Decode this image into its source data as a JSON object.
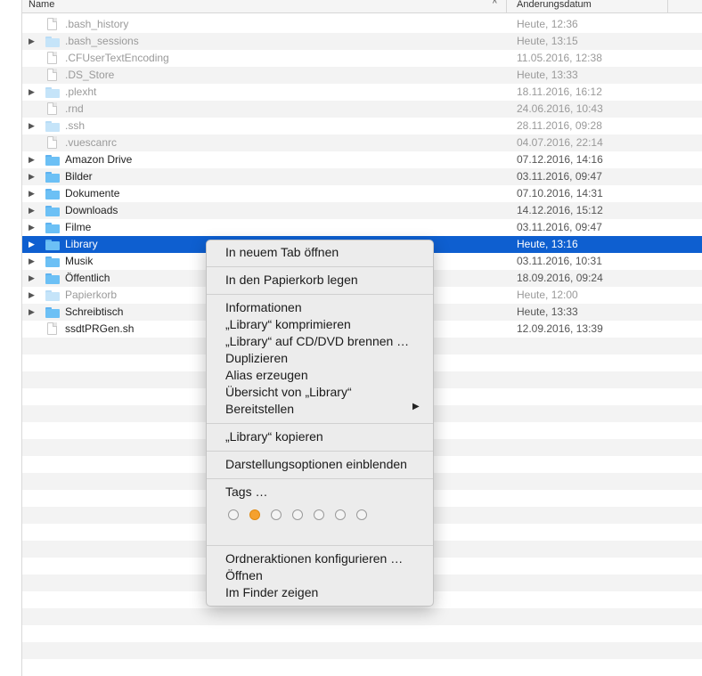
{
  "header": {
    "name_label": "Name",
    "sort_indicator": "^",
    "date_label": "Änderungsdatum"
  },
  "files": [
    {
      "name": ".bash_history",
      "date": "Heute, 12:36",
      "kind": "file",
      "dim": true,
      "expandable": false
    },
    {
      "name": ".bash_sessions",
      "date": "Heute, 13:15",
      "kind": "folder",
      "dim": true,
      "expandable": true
    },
    {
      "name": ".CFUserTextEncoding",
      "date": "11.05.2016, 12:38",
      "kind": "file",
      "dim": true,
      "expandable": false
    },
    {
      "name": ".DS_Store",
      "date": "Heute, 13:33",
      "kind": "file",
      "dim": true,
      "expandable": false
    },
    {
      "name": ".plexht",
      "date": "18.11.2016, 16:12",
      "kind": "folder",
      "dim": true,
      "expandable": true
    },
    {
      "name": ".rnd",
      "date": "24.06.2016, 10:43",
      "kind": "file",
      "dim": true,
      "expandable": false
    },
    {
      "name": ".ssh",
      "date": "28.11.2016, 09:28",
      "kind": "folder",
      "dim": true,
      "expandable": true
    },
    {
      "name": ".vuescanrc",
      "date": "04.07.2016, 22:14",
      "kind": "file",
      "dim": true,
      "expandable": false
    },
    {
      "name": "Amazon Drive",
      "date": "07.12.2016, 14:16",
      "kind": "folder",
      "dim": false,
      "expandable": true
    },
    {
      "name": "Bilder",
      "date": "03.11.2016, 09:47",
      "kind": "folder",
      "dim": false,
      "expandable": true
    },
    {
      "name": "Dokumente",
      "date": "07.10.2016, 14:31",
      "kind": "folder",
      "dim": false,
      "expandable": true
    },
    {
      "name": "Downloads",
      "date": "14.12.2016, 15:12",
      "kind": "folder",
      "dim": false,
      "expandable": true
    },
    {
      "name": "Filme",
      "date": "03.11.2016, 09:47",
      "kind": "folder",
      "dim": false,
      "expandable": true
    },
    {
      "name": "Library",
      "date": "Heute, 13:16",
      "kind": "folder",
      "dim": false,
      "expandable": true,
      "selected": true
    },
    {
      "name": "Musik",
      "date": "03.11.2016, 10:31",
      "kind": "folder",
      "dim": false,
      "expandable": true
    },
    {
      "name": "Öffentlich",
      "date": "18.09.2016, 09:24",
      "kind": "folder",
      "dim": false,
      "expandable": true
    },
    {
      "name": "Papierkorb",
      "date": "Heute, 12:00",
      "kind": "folder",
      "dim": true,
      "expandable": true
    },
    {
      "name": "Schreibtisch",
      "date": "Heute, 13:33",
      "kind": "folder",
      "dim": false,
      "expandable": true
    },
    {
      "name": "ssdtPRGen.sh",
      "date": "12.09.2016, 13:39",
      "kind": "file",
      "dim": false,
      "expandable": false
    }
  ],
  "context_menu": {
    "open_new_tab": "In neuem Tab öffnen",
    "move_to_trash": "In den Papierkorb legen",
    "get_info": "Informationen",
    "compress": "„Library“ komprimieren",
    "burn": "„Library“ auf CD/DVD brennen …",
    "duplicate": "Duplizieren",
    "make_alias": "Alias erzeugen",
    "quick_look": "Übersicht von „Library“",
    "share": "Bereitstellen",
    "share_arrow": "▶",
    "copy": "„Library“ kopieren",
    "view_options": "Darstellungsoptionen einblenden",
    "tags": "Tags …",
    "tag_colors": [
      "none",
      "#f5a12e",
      "none",
      "none",
      "none",
      "none",
      "none"
    ],
    "folder_actions": "Ordneraktionen konfigurieren …",
    "open": "Öffnen",
    "show_in_finder": "Im Finder zeigen"
  },
  "colors": {
    "selection": "#0e5fd0",
    "folder": "#6cc0f5",
    "tag_orange": "#f5a12e"
  }
}
